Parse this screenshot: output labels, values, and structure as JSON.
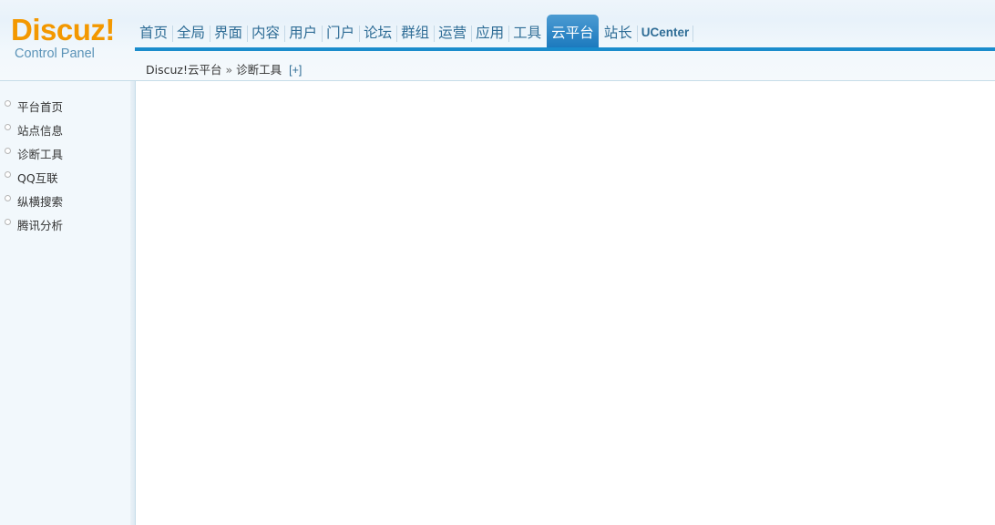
{
  "logo": {
    "brand": "Discuz!",
    "subtitle": "Control Panel"
  },
  "topnav": {
    "items": [
      {
        "label": "首页"
      },
      {
        "label": "全局"
      },
      {
        "label": "界面"
      },
      {
        "label": "内容"
      },
      {
        "label": "用户"
      },
      {
        "label": "门户"
      },
      {
        "label": "论坛"
      },
      {
        "label": "群组"
      },
      {
        "label": "运营"
      },
      {
        "label": "应用"
      },
      {
        "label": "工具"
      },
      {
        "label": "云平台",
        "active": true
      },
      {
        "label": "站长"
      },
      {
        "label": "UCenter"
      }
    ]
  },
  "breadcrumb": {
    "section": "Discuz!云平台",
    "separator": "»",
    "page": "诊断工具",
    "add": "[+]"
  },
  "sidebar": {
    "items": [
      {
        "label": "平台首页"
      },
      {
        "label": "站点信息"
      },
      {
        "label": "诊断工具"
      },
      {
        "label": "QQ互联"
      },
      {
        "label": "纵横搜索"
      },
      {
        "label": "腾讯分析"
      }
    ]
  },
  "colors": {
    "brand_orange": "#f39800",
    "nav_text": "#2f6d96",
    "nav_active_bg": "#1a78bd",
    "nav_bar": "#1a8ccc",
    "sidebar_bg": "#f2f8fc"
  }
}
